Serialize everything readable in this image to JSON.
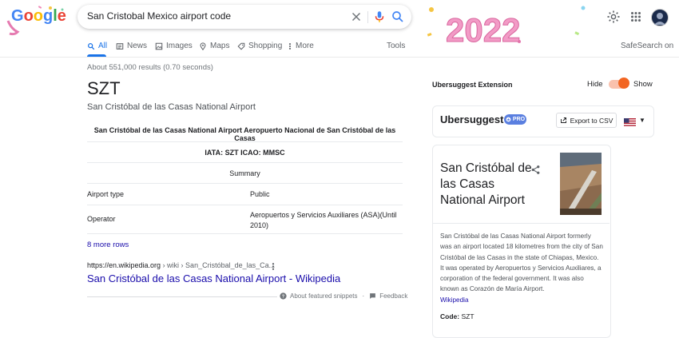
{
  "logo": {
    "text": "Google"
  },
  "search": {
    "query": "San Cristobal Mexico airport code"
  },
  "tabs": [
    {
      "label": "All"
    },
    {
      "label": "News"
    },
    {
      "label": "Images"
    },
    {
      "label": "Maps"
    },
    {
      "label": "Shopping"
    },
    {
      "label": "More"
    }
  ],
  "tools_label": "Tools",
  "safesearch_label": "SafeSearch on",
  "doodle_text": "2022",
  "result_stats": "About 551,000 results (0.70 seconds)",
  "featured": {
    "answer": "SZT",
    "subtitle": "San Cristóbal de las Casas National Airport",
    "table_title": "San Cristóbal de las Casas National Airport Aeropuerto Nacional de San Cristóbal de las Casas",
    "codes": "IATA: SZT ICAO: MMSC",
    "summary_label": "Summary",
    "rows": [
      {
        "key": "Airport type",
        "value": "Public"
      },
      {
        "key": "Operator",
        "value": "Aeropuertos y Servicios Auxiliares (ASA)(Until 2010)"
      }
    ],
    "more_rows": "8 more rows",
    "cite_domain": "https://en.wikipedia.org",
    "cite_path": " › wiki › San_Cristóbal_de_las_Ca...",
    "result_title": "San Cristóbal de las Casas National Airport - Wikipedia",
    "about_snippets": "About featured snippets",
    "separator": "·",
    "feedback": "Feedback"
  },
  "ubersuggest": {
    "extension_label": "Ubersuggest Extension",
    "hide_label": "Hide",
    "show_label": "Show",
    "brand": "Ubersuggest",
    "pro_label": "PRO",
    "export_label": "Export to CSV",
    "toggle_state": "show",
    "accent_color": "#f26522"
  },
  "knowledge_panel": {
    "title": "San Cristóbal de las Casas National Airport",
    "description": "San Cristóbal de las Casas National Airport formerly was an airport located 18 kilometres from the city of San Cristóbal de las Casas in the state of Chiapas, Mexico. It was operated by Aeropuertos y Servicios Auxiliares, a corporation of the federal government. It was also known as Corazón de María Airport.",
    "source_link": "Wikipedia",
    "code_label": "Code:",
    "code_value": "SZT"
  }
}
